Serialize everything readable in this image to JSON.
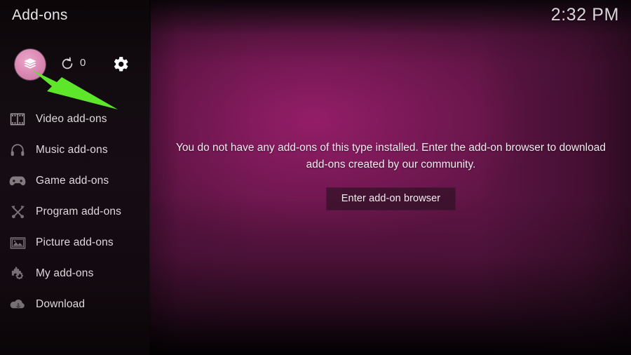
{
  "window": {
    "title": "Add-ons",
    "clock": "2:32 PM"
  },
  "toolbar": {
    "addons_browser_label": "Add-on browser",
    "addons_browser_icon": "package-box-icon",
    "update_label": "Check for updates",
    "update_icon": "refresh-icon",
    "update_count": "0",
    "settings_label": "Settings",
    "settings_icon": "gear-icon"
  },
  "sidebar": {
    "items": [
      {
        "label": "Video add-ons",
        "icon": "film-strip-icon"
      },
      {
        "label": "Music add-ons",
        "icon": "headphones-icon"
      },
      {
        "label": "Game add-ons",
        "icon": "gamepad-icon"
      },
      {
        "label": "Program add-ons",
        "icon": "crossed-tools-icon"
      },
      {
        "label": "Picture add-ons",
        "icon": "picture-frame-icon"
      },
      {
        "label": "My add-ons",
        "icon": "puzzle-gear-icon"
      },
      {
        "label": "Download",
        "icon": "cloud-download-icon"
      }
    ]
  },
  "main": {
    "empty_message": "You do not have any add-ons of this type installed. Enter the add-on browser to download add-ons created by our community.",
    "enter_browser_label": "Enter add-on browser"
  },
  "annotation": {
    "arrow_icon": "green-arrow-icon",
    "arrow_color": "#5ee62b",
    "points_to": "addons-browser-button"
  },
  "colors": {
    "accent_pink": "#dd8cb6",
    "background_magenta": "#8f1c64",
    "sidebar_dark": "#120b10",
    "text_primary": "#e8e4e6",
    "annotation_green": "#5ee62b"
  }
}
